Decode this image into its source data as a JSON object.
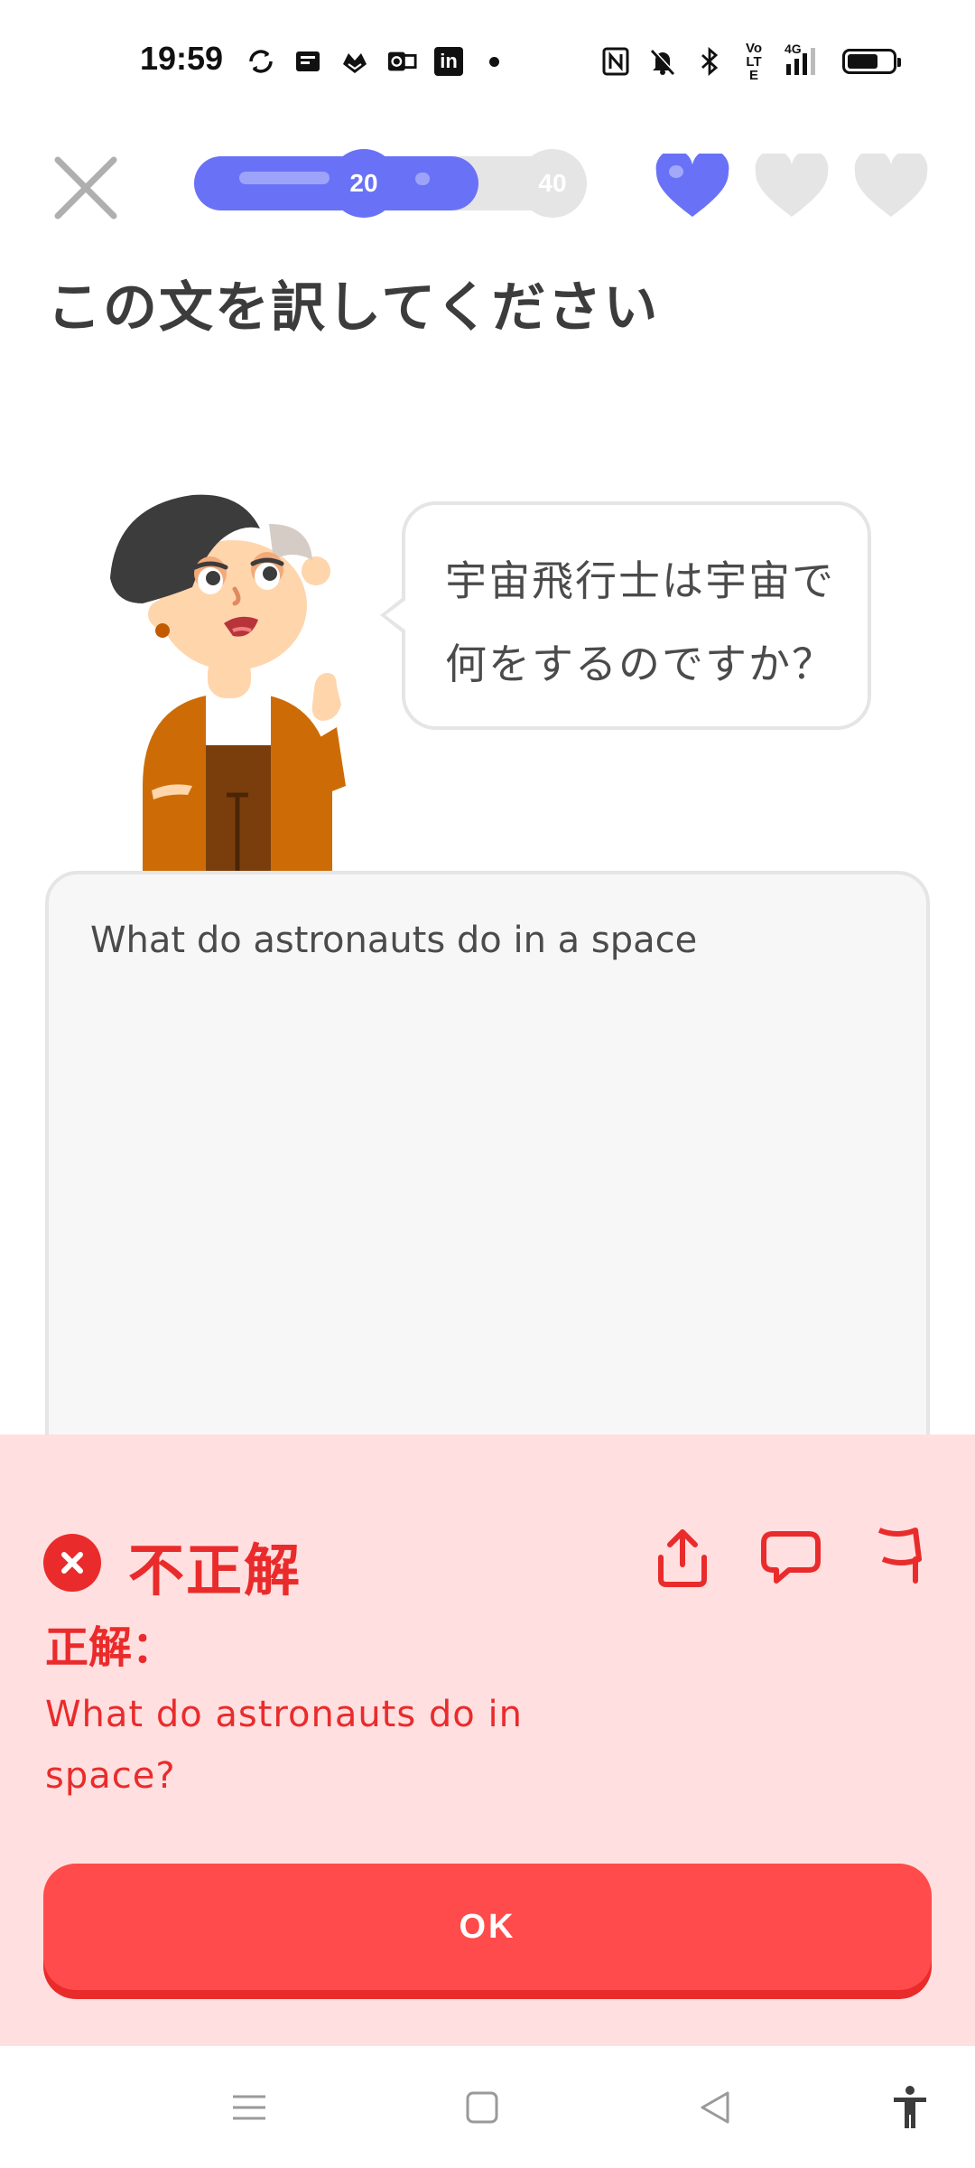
{
  "status_bar": {
    "time": "19:59",
    "left_icons": [
      "sync-icon",
      "book-icon",
      "duolingo-icon",
      "outlook-icon",
      "linkedin-icon",
      "dot-icon"
    ],
    "linkedin_label": "in",
    "right_icons": [
      "nfc-icon",
      "mute-bell-icon",
      "bluetooth-icon",
      "volte-icon",
      "signal-4g-icon",
      "battery-icon"
    ],
    "volte_label": "Vo LTE",
    "network_label": "4G",
    "battery_level": 0.72
  },
  "lesson": {
    "progress": 0.73,
    "milestones": [
      "20",
      "40"
    ],
    "hearts": {
      "total": 3,
      "filled": 1
    },
    "title": "この文を訳してください",
    "prompt_sentence": "宇宙飛行士は宇宙で何をするのですか？",
    "user_answer": "What do astronauts do in a space"
  },
  "feedback": {
    "status": "不正解",
    "correct_label": "正解：",
    "correct_answer": "What do astronauts do in space?",
    "ok_label": "OK"
  },
  "colors": {
    "accent_blue": "#6972f6",
    "error_red": "#ea2b2b",
    "button_red": "#ff4b4b",
    "panel_pink": "#ffdfe0",
    "track_gray": "#e5e5e5"
  },
  "nav": [
    "menu-icon",
    "home-icon",
    "back-icon",
    "accessibility-icon"
  ]
}
